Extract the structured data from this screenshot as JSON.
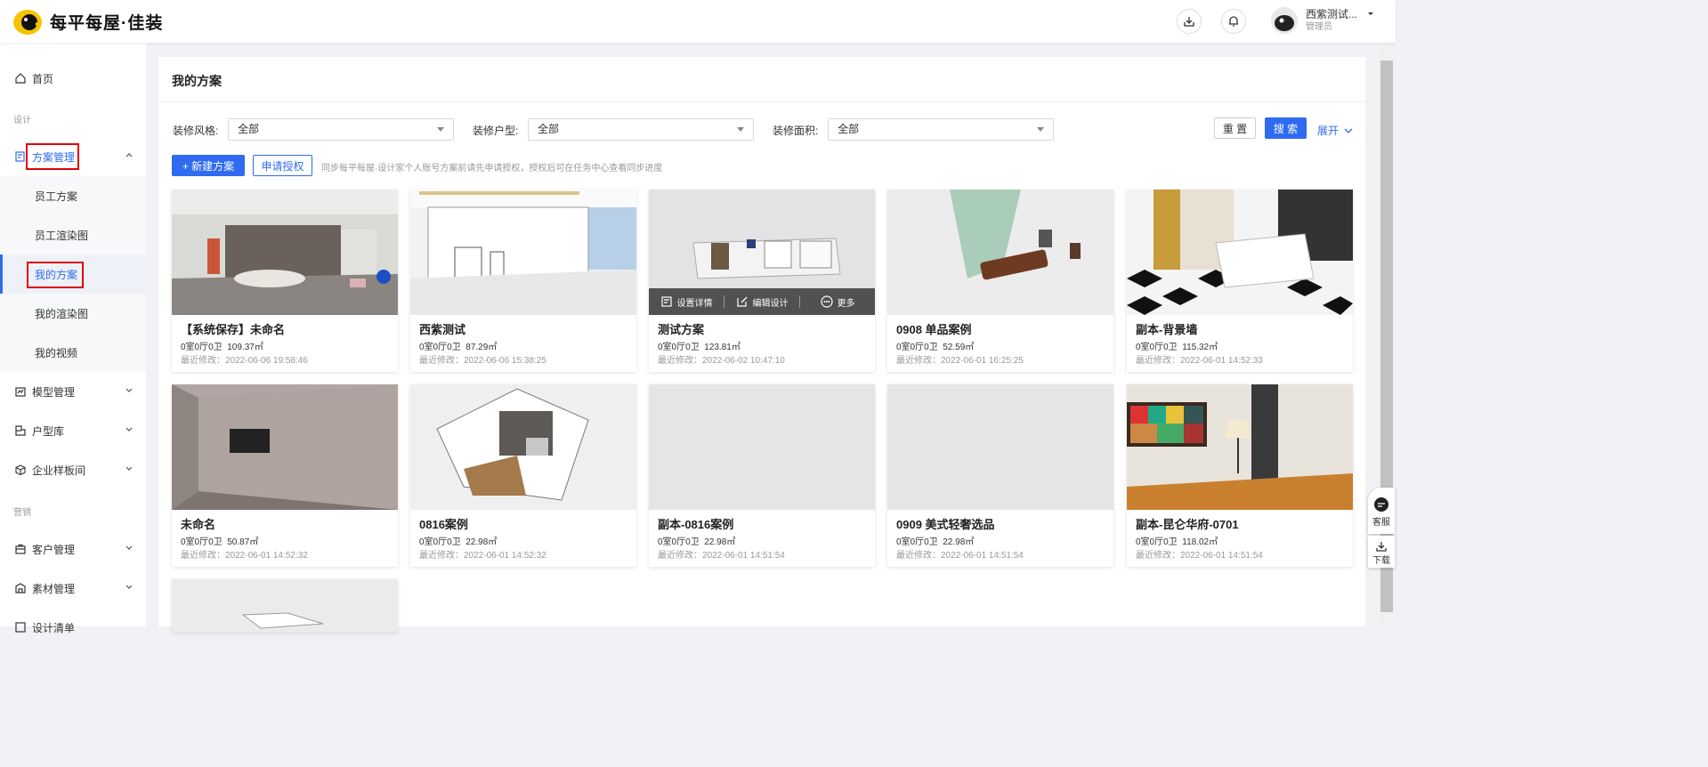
{
  "brand": {
    "name": "每平每屋·佳装"
  },
  "header": {
    "user_name": "西紫测试...",
    "user_role": "管理员",
    "icons": [
      "download-icon",
      "bell-icon"
    ]
  },
  "sidebar": {
    "home": "首页",
    "group_design": "设计",
    "plan_mgmt": "方案管理",
    "sub_items": [
      "员工方案",
      "员工渲染图",
      "我的方案",
      "我的渲染图",
      "我的视频"
    ],
    "model_mgmt": "模型管理",
    "floorplan_lib": "户型库",
    "enterprise_sample": "企业样板间",
    "group_marketing": "营销",
    "customer_mgmt": "客户管理",
    "material_mgmt": "素材管理",
    "design_list": "设计清单"
  },
  "main": {
    "title": "我的方案",
    "filters": [
      {
        "label": "装修风格:",
        "value": "全部"
      },
      {
        "label": "装修户型:",
        "value": "全部"
      },
      {
        "label": "装修面积:",
        "value": "全部"
      }
    ],
    "reset": "重 置",
    "search": "搜 索",
    "expand": "展开",
    "new_plan": "+ 新建方案",
    "apply_auth": "申请授权",
    "hint": "同步每平每屋·设计家个人账号方案前请先申请授权，授权后可在任务中心查看同步进度"
  },
  "hover_actions": {
    "details": "设置详情",
    "edit": "编辑设计",
    "more": "更多"
  },
  "cards": [
    {
      "title": "【系统保存】未命名",
      "rooms": "0室0厅0卫",
      "area": "109.37㎡",
      "modified": "最近修改：2022-06-06 19:58:46"
    },
    {
      "title": "西紫测试",
      "rooms": "0室0厅0卫",
      "area": "87.29㎡",
      "modified": "最近修改：2022-06-06 15:38:25"
    },
    {
      "title": "测试方案",
      "rooms": "0室0厅0卫",
      "area": "123.81㎡",
      "modified": "最近修改：2022-06-02 10:47:10"
    },
    {
      "title": "0908 单品案例",
      "rooms": "0室0厅0卫",
      "area": "52.59㎡",
      "modified": "最近修改：2022-06-01 16:25:25"
    },
    {
      "title": "副本-背景墙",
      "rooms": "0室0厅0卫",
      "area": "115.32㎡",
      "modified": "最近修改：2022-06-01 14:52:33"
    },
    {
      "title": "未命名",
      "rooms": "0室0厅0卫",
      "area": "50.87㎡",
      "modified": "最近修改：2022-06-01 14:52:32"
    },
    {
      "title": "0816案例",
      "rooms": "0室0厅0卫",
      "area": "22.98㎡",
      "modified": "最近修改：2022-06-01 14:52:32"
    },
    {
      "title": "副本-0816案例",
      "rooms": "0室0厅0卫",
      "area": "22.98㎡",
      "modified": "最近修改：2022-06-01 14:51:54"
    },
    {
      "title": "0909 美式轻奢选品",
      "rooms": "0室0厅0卫",
      "area": "22.98㎡",
      "modified": "最近修改：2022-06-01 14:51:54"
    },
    {
      "title": "副本-昆仑华府-0701",
      "rooms": "0室0厅0卫",
      "area": "118.02㎡",
      "modified": "最近修改：2022-06-01 14:51:54"
    }
  ],
  "float_tools": {
    "service": "客服",
    "download": "下载"
  },
  "colors": {
    "primary": "#2f6bf1",
    "highlight": "#e00000"
  }
}
